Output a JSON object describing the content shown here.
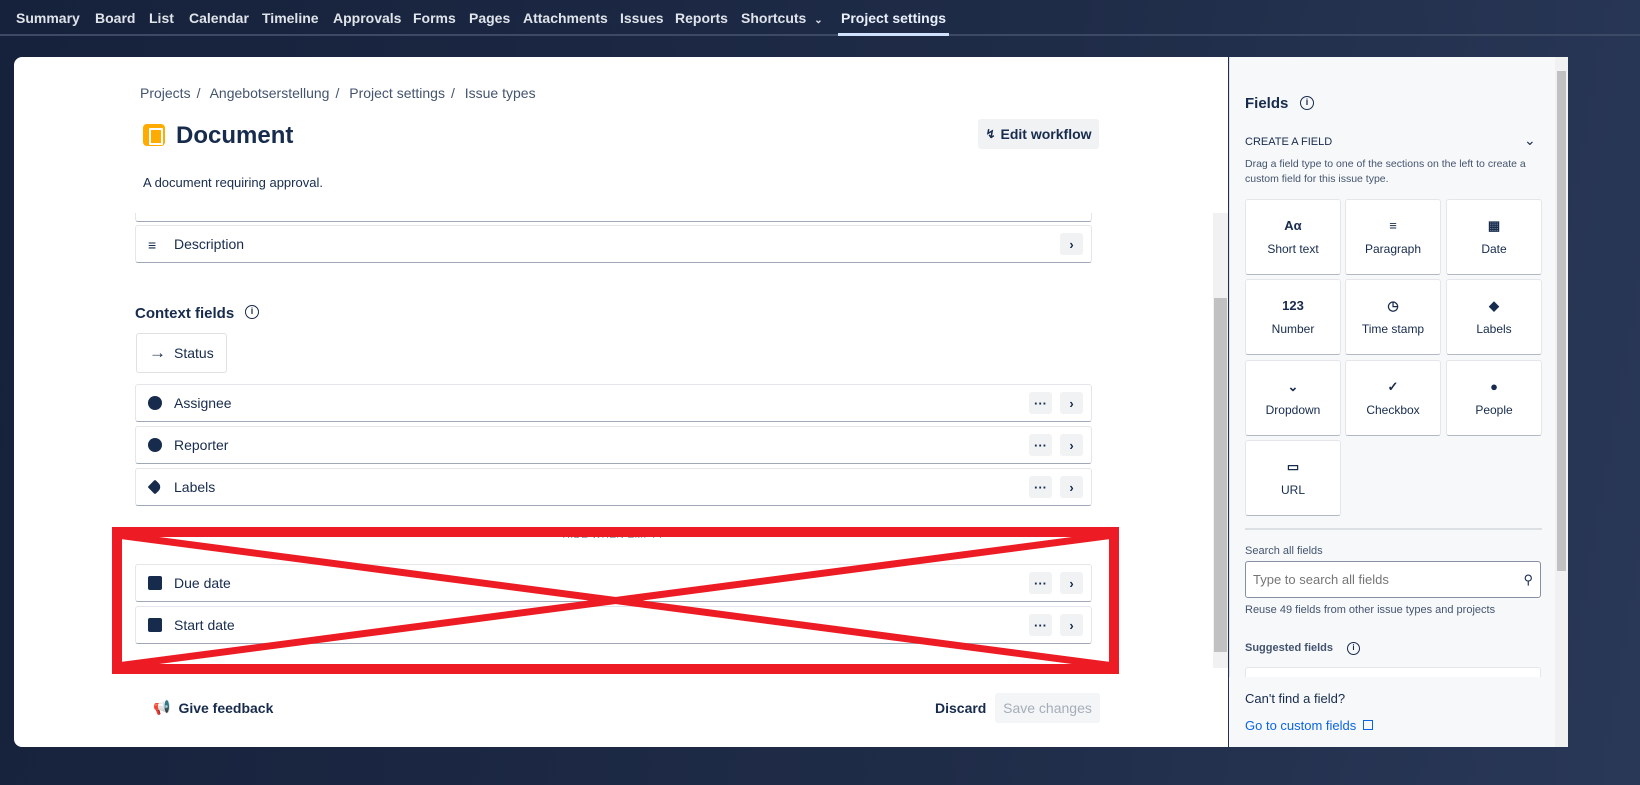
{
  "nav": {
    "items": [
      "Summary",
      "Board",
      "List",
      "Calendar",
      "Timeline",
      "Approvals",
      "Forms",
      "Pages",
      "Attachments",
      "Issues",
      "Reports",
      "Shortcuts",
      "Project settings"
    ],
    "active": "Project settings"
  },
  "breadcrumb": [
    "Projects",
    "Angebotserstellung",
    "Project settings",
    "Issue types"
  ],
  "issue_type": {
    "title": "Document",
    "description": "A document requiring approval.",
    "edit_workflow": "Edit workflow"
  },
  "description_field": "Description",
  "context": {
    "heading": "Context fields",
    "status": "Status",
    "fields": [
      "Assignee",
      "Reporter",
      "Labels"
    ],
    "hide_when_empty": "HIDE WHEN EMPTY",
    "hidden_fields": [
      "Due date",
      "Start date"
    ]
  },
  "footer": {
    "feedback": "Give feedback",
    "discard": "Discard",
    "save": "Save changes"
  },
  "panel": {
    "title": "Fields",
    "create_heading": "CREATE A FIELD",
    "create_desc": "Drag a field type to one of the sections on the left to create a custom field for this issue type.",
    "field_types": [
      {
        "label": "Short text",
        "icon": "Aα"
      },
      {
        "label": "Paragraph",
        "icon": "≡"
      },
      {
        "label": "Date",
        "icon": "▦"
      },
      {
        "label": "Number",
        "icon": "123"
      },
      {
        "label": "Time stamp",
        "icon": "◷"
      },
      {
        "label": "Labels",
        "icon": "◆"
      },
      {
        "label": "Dropdown",
        "icon": "⌄"
      },
      {
        "label": "Checkbox",
        "icon": "✓"
      },
      {
        "label": "People",
        "icon": "●"
      },
      {
        "label": "URL",
        "icon": "▭"
      }
    ],
    "search_label": "Search all fields",
    "search_placeholder": "Type to search all fields",
    "reuse_text": "Reuse 49 fields from other issue types and projects",
    "suggested": "Suggested fields",
    "cant_find": "Can't find a field?",
    "custom_link": "Go to custom fields"
  },
  "colors": {
    "annotation_red": "#ed1c24",
    "accent": "#0c66e4"
  }
}
